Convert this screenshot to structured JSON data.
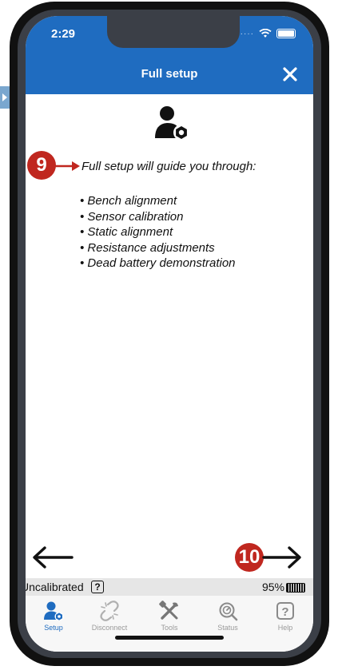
{
  "status_bar": {
    "time": "2:29"
  },
  "navbar": {
    "title": "Full setup"
  },
  "content": {
    "intro": "Full setup will guide you through:",
    "steps": [
      "Bench alignment",
      "Sensor calibration",
      "Static alignment",
      "Resistance adjustments",
      "Dead battery demonstration"
    ]
  },
  "annotations": {
    "badge_a": "9",
    "badge_b": "10"
  },
  "status_strip": {
    "calibration": "Uncalibrated",
    "help_symbol": "?",
    "battery_percent": "95%"
  },
  "tabs": [
    {
      "label": "Setup",
      "icon": "user-gear-icon",
      "active": true
    },
    {
      "label": "Disconnect",
      "icon": "broken-link-icon",
      "active": false
    },
    {
      "label": "Tools",
      "icon": "tools-icon",
      "active": false
    },
    {
      "label": "Status",
      "icon": "status-gauge-icon",
      "active": false
    },
    {
      "label": "Help",
      "icon": "help-icon",
      "active": false
    }
  ],
  "colors": {
    "brand_blue": "#1f6cc0",
    "badge_red": "#c0271f",
    "inactive_tab": "#9a9a9a"
  }
}
